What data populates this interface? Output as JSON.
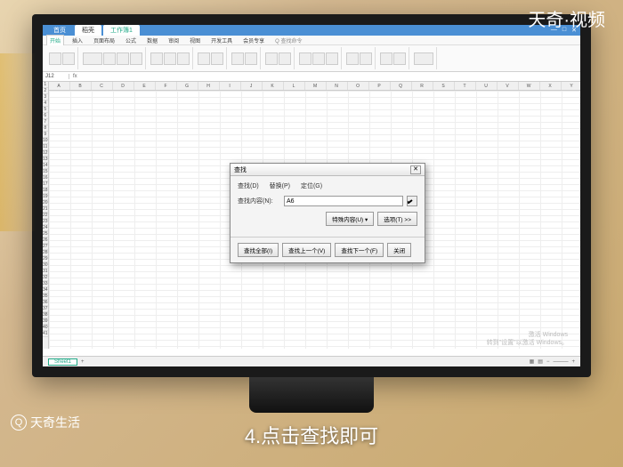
{
  "watermark_top": "天奇·视频",
  "watermark_bottom": "天奇生活",
  "subtitle": "4.点击查找即可",
  "titlebar": {
    "app_tab": "首页",
    "doc_tab": "工作簿1",
    "tab2": "稻壳"
  },
  "ribbon_tabs": [
    "开始",
    "插入",
    "页面布局",
    "公式",
    "数据",
    "审阅",
    "视图",
    "开发工具",
    "会员专享",
    "Q 查找命令"
  ],
  "formula": {
    "namebox": "J12",
    "fx": "fx"
  },
  "columns": [
    "A",
    "B",
    "C",
    "D",
    "E",
    "F",
    "G",
    "H",
    "I",
    "J",
    "K",
    "L",
    "M",
    "N",
    "O",
    "P",
    "Q",
    "R",
    "S",
    "T",
    "U",
    "V",
    "W",
    "X",
    "Y"
  ],
  "dialog": {
    "title": "查找",
    "tabs": {
      "find": "查找(D)",
      "replace": "替换(P)",
      "goto": "定位(G)"
    },
    "find_label": "查找内容(N):",
    "find_value": "A6",
    "special_btn": "特殊内容(U) ▾",
    "options_btn": "选项(T) >>",
    "actions": {
      "find_all": "查找全部(I)",
      "find_prev": "查找上一个(V)",
      "find_next": "查找下一个(F)",
      "close": "关闭"
    }
  },
  "statusbar": {
    "sheet": "Sheet1",
    "add": "+"
  },
  "activate": {
    "line1": "激活 Windows",
    "line2": "转到\"设置\"以激活 Windows。"
  }
}
